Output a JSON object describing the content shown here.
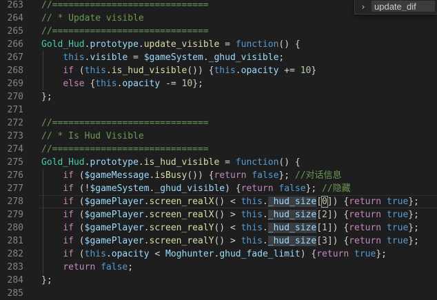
{
  "editor": {
    "lines": [
      {
        "n": "263",
        "tokens": [
          {
            "t": "//=============================",
            "c": "cmt"
          }
        ]
      },
      {
        "n": "264",
        "tokens": [
          {
            "t": "// * Update visible",
            "c": "cmt"
          }
        ]
      },
      {
        "n": "265",
        "tokens": [
          {
            "t": "//=============================",
            "c": "cmt"
          }
        ]
      },
      {
        "n": "266",
        "tokens": [
          {
            "t": "Gold_Hud",
            "c": "cls"
          },
          {
            "t": "."
          },
          {
            "t": "prototype",
            "c": "vr"
          },
          {
            "t": "."
          },
          {
            "t": "update_visible",
            "c": "fn"
          },
          {
            "t": " = "
          },
          {
            "t": "function",
            "c": "kw"
          },
          {
            "t": "() {"
          }
        ]
      },
      {
        "n": "267",
        "indent": 1,
        "tokens": [
          {
            "t": "    "
          },
          {
            "t": "this",
            "c": "kw"
          },
          {
            "t": "."
          },
          {
            "t": "visible",
            "c": "vr"
          },
          {
            "t": " = "
          },
          {
            "t": "$gameSystem",
            "c": "vr"
          },
          {
            "t": "."
          },
          {
            "t": "_ghud_visible",
            "c": "vr"
          },
          {
            "t": ";"
          }
        ]
      },
      {
        "n": "268",
        "indent": 1,
        "tokens": [
          {
            "t": "    "
          },
          {
            "t": "if",
            "c": "kw2"
          },
          {
            "t": " ("
          },
          {
            "t": "this",
            "c": "kw"
          },
          {
            "t": "."
          },
          {
            "t": "is_hud_visible",
            "c": "fn"
          },
          {
            "t": "()) {"
          },
          {
            "t": "this",
            "c": "kw"
          },
          {
            "t": "."
          },
          {
            "t": "opacity",
            "c": "vr"
          },
          {
            "t": " += "
          },
          {
            "t": "10",
            "c": "num"
          },
          {
            "t": "}"
          }
        ]
      },
      {
        "n": "269",
        "indent": 1,
        "tokens": [
          {
            "t": "    "
          },
          {
            "t": "else",
            "c": "kw2"
          },
          {
            "t": " {"
          },
          {
            "t": "this",
            "c": "kw"
          },
          {
            "t": "."
          },
          {
            "t": "opacity",
            "c": "vr"
          },
          {
            "t": " -= "
          },
          {
            "t": "10",
            "c": "num"
          },
          {
            "t": "};"
          }
        ]
      },
      {
        "n": "270",
        "tokens": [
          {
            "t": "};"
          }
        ]
      },
      {
        "n": "271",
        "tokens": []
      },
      {
        "n": "272",
        "tokens": [
          {
            "t": "//=============================",
            "c": "cmt"
          }
        ]
      },
      {
        "n": "273",
        "tokens": [
          {
            "t": "// * Is Hud Visible",
            "c": "cmt"
          }
        ]
      },
      {
        "n": "274",
        "tokens": [
          {
            "t": "//=============================",
            "c": "cmt"
          }
        ]
      },
      {
        "n": "275",
        "tokens": [
          {
            "t": "Gold_Hud",
            "c": "cls"
          },
          {
            "t": "."
          },
          {
            "t": "prototype",
            "c": "vr"
          },
          {
            "t": "."
          },
          {
            "t": "is_hud_visible",
            "c": "fn"
          },
          {
            "t": " = "
          },
          {
            "t": "function",
            "c": "kw"
          },
          {
            "t": "() {"
          }
        ]
      },
      {
        "n": "276",
        "indent": 1,
        "tokens": [
          {
            "t": "    "
          },
          {
            "t": "if",
            "c": "kw2"
          },
          {
            "t": " ("
          },
          {
            "t": "$gameMessage",
            "c": "vr"
          },
          {
            "t": "."
          },
          {
            "t": "isBusy",
            "c": "fn"
          },
          {
            "t": "()) {"
          },
          {
            "t": "return",
            "c": "kw2"
          },
          {
            "t": " "
          },
          {
            "t": "false",
            "c": "kw"
          },
          {
            "t": "}; "
          },
          {
            "t": "//对话信息",
            "c": "cmt"
          }
        ]
      },
      {
        "n": "277",
        "indent": 1,
        "tokens": [
          {
            "t": "    "
          },
          {
            "t": "if",
            "c": "kw2"
          },
          {
            "t": " (!"
          },
          {
            "t": "$gameSystem",
            "c": "vr"
          },
          {
            "t": "."
          },
          {
            "t": "_ghud_visible",
            "c": "vr"
          },
          {
            "t": ") {"
          },
          {
            "t": "return",
            "c": "kw2"
          },
          {
            "t": " "
          },
          {
            "t": "false",
            "c": "kw"
          },
          {
            "t": "}; "
          },
          {
            "t": "//隐藏",
            "c": "cmt"
          }
        ]
      },
      {
        "n": "278",
        "indent": 1,
        "current": true,
        "tokens": [
          {
            "t": "    "
          },
          {
            "t": "if",
            "c": "kw2"
          },
          {
            "t": " ("
          },
          {
            "t": "$gamePlayer",
            "c": "vr"
          },
          {
            "t": "."
          },
          {
            "t": "screen_realX",
            "c": "fn"
          },
          {
            "t": "() < "
          },
          {
            "t": "this",
            "c": "kw"
          },
          {
            "t": "."
          },
          {
            "t": "_hud_size",
            "c": "vr",
            "hl": true
          },
          {
            "t": "["
          },
          {
            "t": "0",
            "c": "num",
            "cursor": true
          },
          {
            "t": "]) {"
          },
          {
            "t": "return",
            "c": "kw2"
          },
          {
            "t": " "
          },
          {
            "t": "true",
            "c": "kw"
          },
          {
            "t": "};"
          }
        ]
      },
      {
        "n": "279",
        "indent": 1,
        "tokens": [
          {
            "t": "    "
          },
          {
            "t": "if",
            "c": "kw2"
          },
          {
            "t": " ("
          },
          {
            "t": "$gamePlayer",
            "c": "vr"
          },
          {
            "t": "."
          },
          {
            "t": "screen_realX",
            "c": "fn"
          },
          {
            "t": "() > "
          },
          {
            "t": "this",
            "c": "kw"
          },
          {
            "t": "."
          },
          {
            "t": "_hud_size",
            "c": "vr",
            "hl": true
          },
          {
            "t": "["
          },
          {
            "t": "2",
            "c": "num"
          },
          {
            "t": "]) {"
          },
          {
            "t": "return",
            "c": "kw2"
          },
          {
            "t": " "
          },
          {
            "t": "true",
            "c": "kw"
          },
          {
            "t": "};"
          }
        ]
      },
      {
        "n": "280",
        "indent": 1,
        "tokens": [
          {
            "t": "    "
          },
          {
            "t": "if",
            "c": "kw2"
          },
          {
            "t": " ("
          },
          {
            "t": "$gamePlayer",
            "c": "vr"
          },
          {
            "t": "."
          },
          {
            "t": "screen_realY",
            "c": "fn"
          },
          {
            "t": "() < "
          },
          {
            "t": "this",
            "c": "kw"
          },
          {
            "t": "."
          },
          {
            "t": "_hud_size",
            "c": "vr",
            "hl": true
          },
          {
            "t": "["
          },
          {
            "t": "1",
            "c": "num"
          },
          {
            "t": "]) {"
          },
          {
            "t": "return",
            "c": "kw2"
          },
          {
            "t": " "
          },
          {
            "t": "true",
            "c": "kw"
          },
          {
            "t": "};"
          }
        ]
      },
      {
        "n": "281",
        "indent": 1,
        "tokens": [
          {
            "t": "    "
          },
          {
            "t": "if",
            "c": "kw2"
          },
          {
            "t": " ("
          },
          {
            "t": "$gamePlayer",
            "c": "vr"
          },
          {
            "t": "."
          },
          {
            "t": "screen_realY",
            "c": "fn"
          },
          {
            "t": "() > "
          },
          {
            "t": "this",
            "c": "kw"
          },
          {
            "t": "."
          },
          {
            "t": "_hud_size",
            "c": "vr",
            "hl": true
          },
          {
            "t": "["
          },
          {
            "t": "3",
            "c": "num"
          },
          {
            "t": "]) {"
          },
          {
            "t": "return",
            "c": "kw2"
          },
          {
            "t": " "
          },
          {
            "t": "true",
            "c": "kw"
          },
          {
            "t": "};"
          }
        ]
      },
      {
        "n": "282",
        "indent": 1,
        "tokens": [
          {
            "t": "    "
          },
          {
            "t": "if",
            "c": "kw2"
          },
          {
            "t": " ("
          },
          {
            "t": "this",
            "c": "kw"
          },
          {
            "t": "."
          },
          {
            "t": "opacity",
            "c": "vr"
          },
          {
            "t": " < "
          },
          {
            "t": "Moghunter",
            "c": "vr"
          },
          {
            "t": "."
          },
          {
            "t": "ghud_fade_limit",
            "c": "vr"
          },
          {
            "t": ") {"
          },
          {
            "t": "return",
            "c": "kw2"
          },
          {
            "t": " "
          },
          {
            "t": "true",
            "c": "kw"
          },
          {
            "t": "};"
          }
        ]
      },
      {
        "n": "283",
        "indent": 1,
        "tokens": [
          {
            "t": "    "
          },
          {
            "t": "return",
            "c": "kw2"
          },
          {
            "t": " "
          },
          {
            "t": "false",
            "c": "kw"
          },
          {
            "t": ";"
          }
        ]
      },
      {
        "n": "284",
        "tokens": [
          {
            "t": "};"
          }
        ]
      },
      {
        "n": "285",
        "tokens": []
      }
    ]
  },
  "find_widget": {
    "toggle_icon": "chevron-right-icon",
    "toggle_glyph": "›",
    "query": "update_dif"
  },
  "colors": {
    "background": "#1e1e1e",
    "comment": "#6a9955",
    "keyword": "#569cd6",
    "control": "#c586c0",
    "function": "#dcdcaa",
    "class": "#4ec9b0",
    "variable": "#9cdcfe",
    "number": "#b5cea8",
    "line_number": "#858585"
  }
}
